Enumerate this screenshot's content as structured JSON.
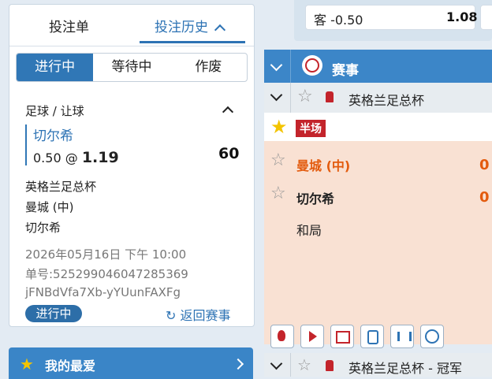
{
  "tabs": {
    "bet_slip": "投注单",
    "history": "投注历史"
  },
  "filters": {
    "in_progress": "进行中",
    "pending": "等待中",
    "void": "作废"
  },
  "bet": {
    "market": "足球 / 让球",
    "selection": "切尔希",
    "handicap": "0.50 @",
    "odds": "1.19",
    "stake": "60",
    "competition": "英格兰足总杯",
    "home": "曼城 (中)",
    "away": "切尔希",
    "datetime": "2026年05月16日 下午 10:00",
    "ticket": "单号:525299046047285369",
    "code": "jFNBdVfa7Xb-yYUunFAXFg",
    "status": "进行中",
    "back_label": "返回赛事"
  },
  "favorites": {
    "label": "我的最爱"
  },
  "top_odds": {
    "label": "客 -0.50",
    "value": "1.08"
  },
  "events": {
    "header": "赛事",
    "league": "英格兰足总杯",
    "period_badge": "半场",
    "home": "曼城 (中)",
    "home_score": "0",
    "away": "切尔希",
    "away_score": "0",
    "draw": "和局",
    "league2": "英格兰足总杯 - 冠军"
  }
}
